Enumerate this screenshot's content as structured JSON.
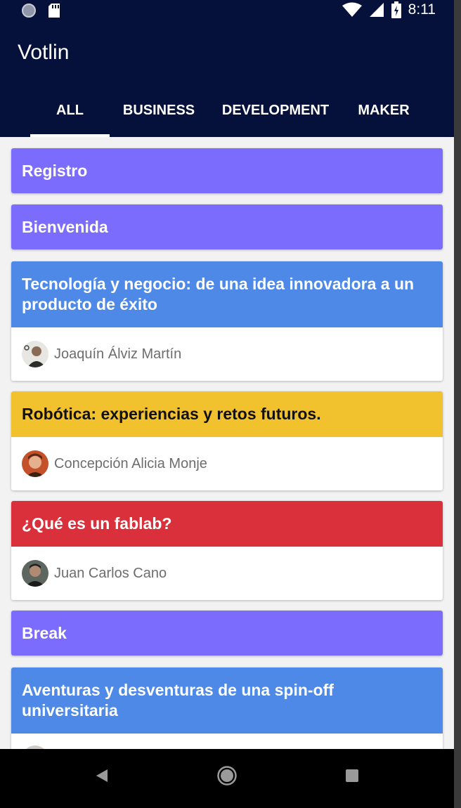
{
  "status": {
    "time": "8:11"
  },
  "app": {
    "title": "Votlin"
  },
  "tabs": [
    {
      "label": "ALL",
      "selected": true
    },
    {
      "label": "BUSINESS",
      "selected": false
    },
    {
      "label": "DEVELOPMENT",
      "selected": false
    },
    {
      "label": "MAKER",
      "selected": false
    }
  ],
  "colors": {
    "appbar": "#05113a",
    "general": "#7b6cfe",
    "business": "#4e89e8",
    "maker": "#f2c12e",
    "development": "#d9303b"
  },
  "talks": [
    {
      "title": "Registro",
      "category": "general"
    },
    {
      "title": "Bienvenida",
      "category": "general"
    },
    {
      "title": "Tecnología y negocio: de una idea innovadora a un producto de éxito",
      "category": "business",
      "speaker": "Joaquín Álviz Martín"
    },
    {
      "title": "Robótica: experiencias y retos futuros.",
      "category": "maker",
      "speaker": "Concepción Alicia Monje"
    },
    {
      "title": "¿Qué es un fablab?",
      "category": "development",
      "speaker": "Juan Carlos Cano"
    },
    {
      "title": "Break",
      "category": "general"
    },
    {
      "title": "Aventuras y desventuras de una spin-off universitaria",
      "category": "business"
    }
  ]
}
